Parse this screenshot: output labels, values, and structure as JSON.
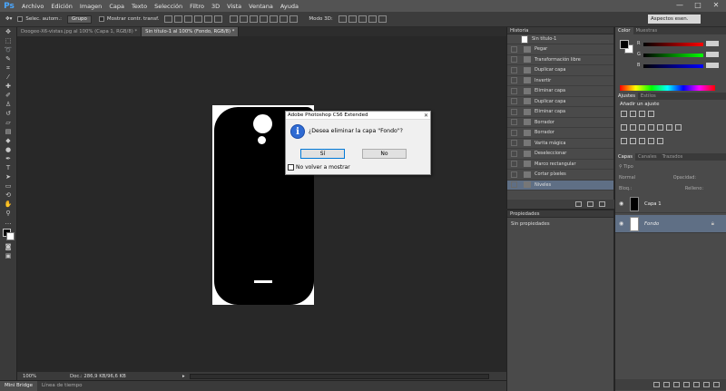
{
  "app": {
    "logo": "Ps"
  },
  "menu": [
    "Archivo",
    "Edición",
    "Imagen",
    "Capa",
    "Texto",
    "Selección",
    "Filtro",
    "3D",
    "Vista",
    "Ventana",
    "Ayuda"
  ],
  "window_controls": {
    "minimize": "—",
    "maximize": "□",
    "close": "✕"
  },
  "options": {
    "auto_select_label": "Selec. autom.:",
    "group_value": "Grupo",
    "show_transform_label": "Mostrar contr. transf.",
    "mode3d_label": "Modo 3D:",
    "workspace": "Aspectos esen."
  },
  "tabs": [
    {
      "label": "Doogee-X6-vistas.jpg al 100% (Capa 1, RGB/8) *",
      "active": false
    },
    {
      "label": "Sin título-1 al 100% (Fondo, RGB/8) *",
      "active": true
    }
  ],
  "status": {
    "zoom": "100%",
    "doc": "Doc.: 286,9 KB/96,6 KB"
  },
  "bottom_tabs": [
    "Mini Bridge",
    "Línea de tiempo"
  ],
  "dialog": {
    "title": "Adobe Photoshop CS6 Extended",
    "message": "¿Desea eliminar la capa \"Fondo\"?",
    "yes": "Sí",
    "no": "No",
    "checkbox": "No volver a mostrar",
    "close": "✕"
  },
  "history": {
    "title": "Historia",
    "snapshot": "Sin título-1",
    "items": [
      "Pegar",
      "Transformación libre",
      "Duplicar capa",
      "Invertir",
      "Eliminar capa",
      "Duplicar capa",
      "Eliminar capa",
      "Borrador",
      "Borrador",
      "Varita mágica",
      "Deseleccionar",
      "Marco rectangular",
      "Cortar píxeles",
      "Niveles"
    ]
  },
  "properties": {
    "title": "Propiedades",
    "text": "Sin propiedades"
  },
  "color_panel": {
    "tabs": [
      "Color",
      "Muestras"
    ],
    "channels": [
      "R",
      "G",
      "B"
    ]
  },
  "adjust_panel": {
    "tabs": [
      "Ajustes",
      "Estilos"
    ],
    "title": "Añadir un ajuste"
  },
  "layers_panel": {
    "tabs": [
      "Capas",
      "Canales",
      "Trazados"
    ],
    "filter": "Tipo",
    "blend": "Normal",
    "opacity_label": "Opacidad:",
    "lock_label": "Bloq.:",
    "fill_label": "Relleno:",
    "layers": [
      {
        "name": "Capa 1",
        "selected": false
      },
      {
        "name": "Fondo",
        "selected": true
      }
    ]
  },
  "colors": {
    "accent_blue": "#2f6bd3",
    "selection": "#5f6f85"
  }
}
